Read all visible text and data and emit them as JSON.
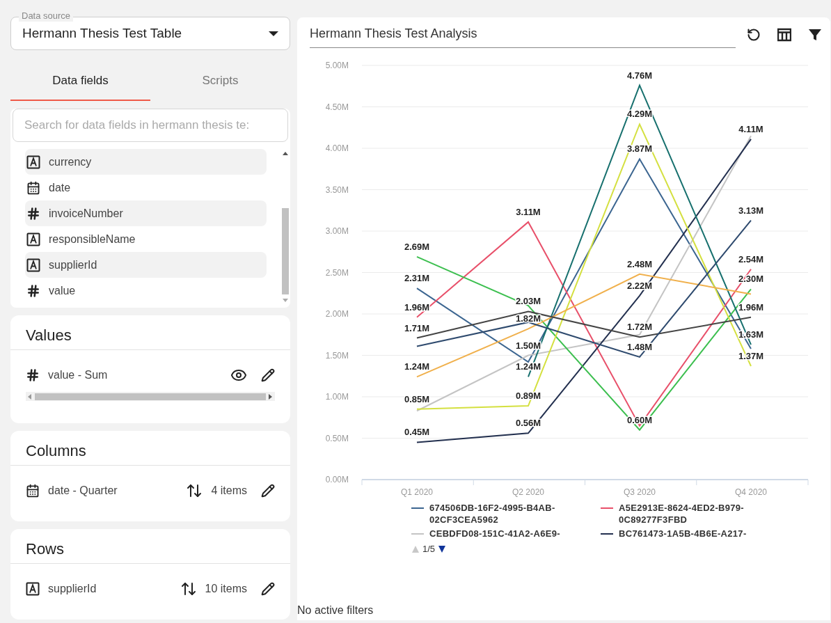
{
  "data_source": {
    "label": "Data source",
    "value": "Hermann Thesis Test Table"
  },
  "tabs": [
    {
      "label": "Data fields",
      "selected": true
    },
    {
      "label": "Scripts",
      "selected": false
    }
  ],
  "search": {
    "placeholder": "Search for data fields in hermann thesis te:"
  },
  "fields": [
    {
      "kind": "text",
      "name": "currency"
    },
    {
      "kind": "date",
      "name": "date"
    },
    {
      "kind": "number",
      "name": "invoiceNumber"
    },
    {
      "kind": "text",
      "name": "responsibleName"
    },
    {
      "kind": "text",
      "name": "supplierId"
    },
    {
      "kind": "number",
      "name": "value"
    }
  ],
  "sections": [
    {
      "title": "Values",
      "items": [
        {
          "kind": "number",
          "name": "value - Sum",
          "visible": true,
          "scroll": true
        }
      ]
    },
    {
      "title": "Columns",
      "items": [
        {
          "kind": "date",
          "name": "date - Quarter",
          "count": "4 items"
        }
      ]
    },
    {
      "title": "Rows",
      "items": [
        {
          "kind": "text",
          "name": "supplierId",
          "count": "10 items"
        }
      ]
    }
  ],
  "analysis": {
    "title": "Hermann Thesis Test Analysis",
    "chart_data": {
      "type": "line",
      "grid": true,
      "legend": true,
      "categories": [
        "Q1 2020",
        "Q2 2020",
        "Q3 2020",
        "Q4 2020"
      ],
      "ylim": [
        0,
        5
      ],
      "yticks": [
        {
          "value": 0,
          "label": "0.00M"
        },
        {
          "value": 0.5,
          "label": "0.50M"
        },
        {
          "value": 1,
          "label": "1.00M"
        },
        {
          "value": 1.5,
          "label": "1.50M"
        },
        {
          "value": 2,
          "label": "2.00M"
        },
        {
          "value": 2.5,
          "label": "2.50M"
        },
        {
          "value": 3,
          "label": "3.00M"
        },
        {
          "value": 3.5,
          "label": "3.50M"
        },
        {
          "value": 4,
          "label": "4.00M"
        },
        {
          "value": 4.5,
          "label": "4.50M"
        },
        {
          "value": 5,
          "label": "5.00M"
        }
      ],
      "series": [
        {
          "name": "674506DB-16F2-4995-B4AB-02CF3CEA5962",
          "color": "#3b6590",
          "values": [
            2.31,
            1.42,
            3.87,
            1.58
          ]
        },
        {
          "name": "A5E2913E-8624-4ED2-B979-0C89277F3FBD",
          "color": "#e8506a",
          "values": [
            1.96,
            3.11,
            0.65,
            2.54
          ]
        },
        {
          "name": "CEBDFD08-151C-41A2-A6E9-",
          "color": "#c4c4c4",
          "values": [
            0.83,
            1.5,
            1.75,
            4.15
          ]
        },
        {
          "name": "BC761473-1A5B-4B6E-A217-",
          "color": "#23304f",
          "values": [
            0.45,
            0.56,
            2.22,
            4.11
          ]
        },
        {
          "color": "#3cbf4f",
          "values": [
            2.69,
            2.1,
            0.6,
            2.3
          ]
        },
        {
          "color": "#17706e",
          "values": [
            null,
            1.24,
            4.76,
            1.63
          ]
        },
        {
          "color": "#d4e040",
          "values": [
            0.85,
            0.89,
            4.29,
            1.37
          ]
        },
        {
          "color": "#f0b04c",
          "values": [
            1.24,
            1.82,
            2.48,
            2.24
          ]
        },
        {
          "color": "#444444",
          "values": [
            1.71,
            2.03,
            1.72,
            1.96
          ]
        },
        {
          "color": "#2e4a6e",
          "values": [
            1.61,
            1.9,
            1.48,
            3.13
          ]
        }
      ],
      "annotations": [
        {
          "x": "Q1 2020",
          "y": 2.69,
          "text": "2.69M"
        },
        {
          "x": "Q1 2020",
          "y": 2.31,
          "text": "2.31M"
        },
        {
          "x": "Q1 2020",
          "y": 1.96,
          "text": "1.96M"
        },
        {
          "x": "Q1 2020",
          "y": 1.71,
          "text": "1.71M"
        },
        {
          "x": "Q1 2020",
          "y": 1.24,
          "text": "1.24M"
        },
        {
          "x": "Q1 2020",
          "y": 0.85,
          "text": "0.85M"
        },
        {
          "x": "Q1 2020",
          "y": 0.45,
          "text": "0.45M"
        },
        {
          "x": "Q2 2020",
          "y": 3.11,
          "text": "3.11M"
        },
        {
          "x": "Q2 2020",
          "y": 2.03,
          "text": "2.03M"
        },
        {
          "x": "Q2 2020",
          "y": 1.82,
          "text": "1.82M"
        },
        {
          "x": "Q2 2020",
          "y": 1.5,
          "text": "1.50M"
        },
        {
          "x": "Q2 2020",
          "y": 1.24,
          "text": "1.24M"
        },
        {
          "x": "Q2 2020",
          "y": 0.89,
          "text": "0.89M"
        },
        {
          "x": "Q2 2020",
          "y": 0.56,
          "text": "0.56M"
        },
        {
          "x": "Q3 2020",
          "y": 4.76,
          "text": "4.76M"
        },
        {
          "x": "Q3 2020",
          "y": 4.29,
          "text": "4.29M"
        },
        {
          "x": "Q3 2020",
          "y": 3.87,
          "text": "3.87M"
        },
        {
          "x": "Q3 2020",
          "y": 2.48,
          "text": "2.48M"
        },
        {
          "x": "Q3 2020",
          "y": 2.22,
          "text": "2.22M"
        },
        {
          "x": "Q3 2020",
          "y": 1.72,
          "text": "1.72M"
        },
        {
          "x": "Q3 2020",
          "y": 1.48,
          "text": "1.48M"
        },
        {
          "x": "Q3 2020",
          "y": 0.6,
          "text": "0.60M"
        },
        {
          "x": "Q4 2020",
          "y": 4.11,
          "text": "4.11M"
        },
        {
          "x": "Q4 2020",
          "y": 3.13,
          "text": "3.13M"
        },
        {
          "x": "Q4 2020",
          "y": 2.54,
          "text": "2.54M"
        },
        {
          "x": "Q4 2020",
          "y": 2.3,
          "text": "2.30M"
        },
        {
          "x": "Q4 2020",
          "y": 1.96,
          "text": "1.96M"
        },
        {
          "x": "Q4 2020",
          "y": 1.63,
          "text": "1.63M"
        },
        {
          "x": "Q4 2020",
          "y": 1.37,
          "text": "1.37M"
        }
      ]
    },
    "legend_pager": {
      "page": "1/5",
      "prev_disabled": true,
      "next_disabled": false
    }
  },
  "filters": "No active filters"
}
